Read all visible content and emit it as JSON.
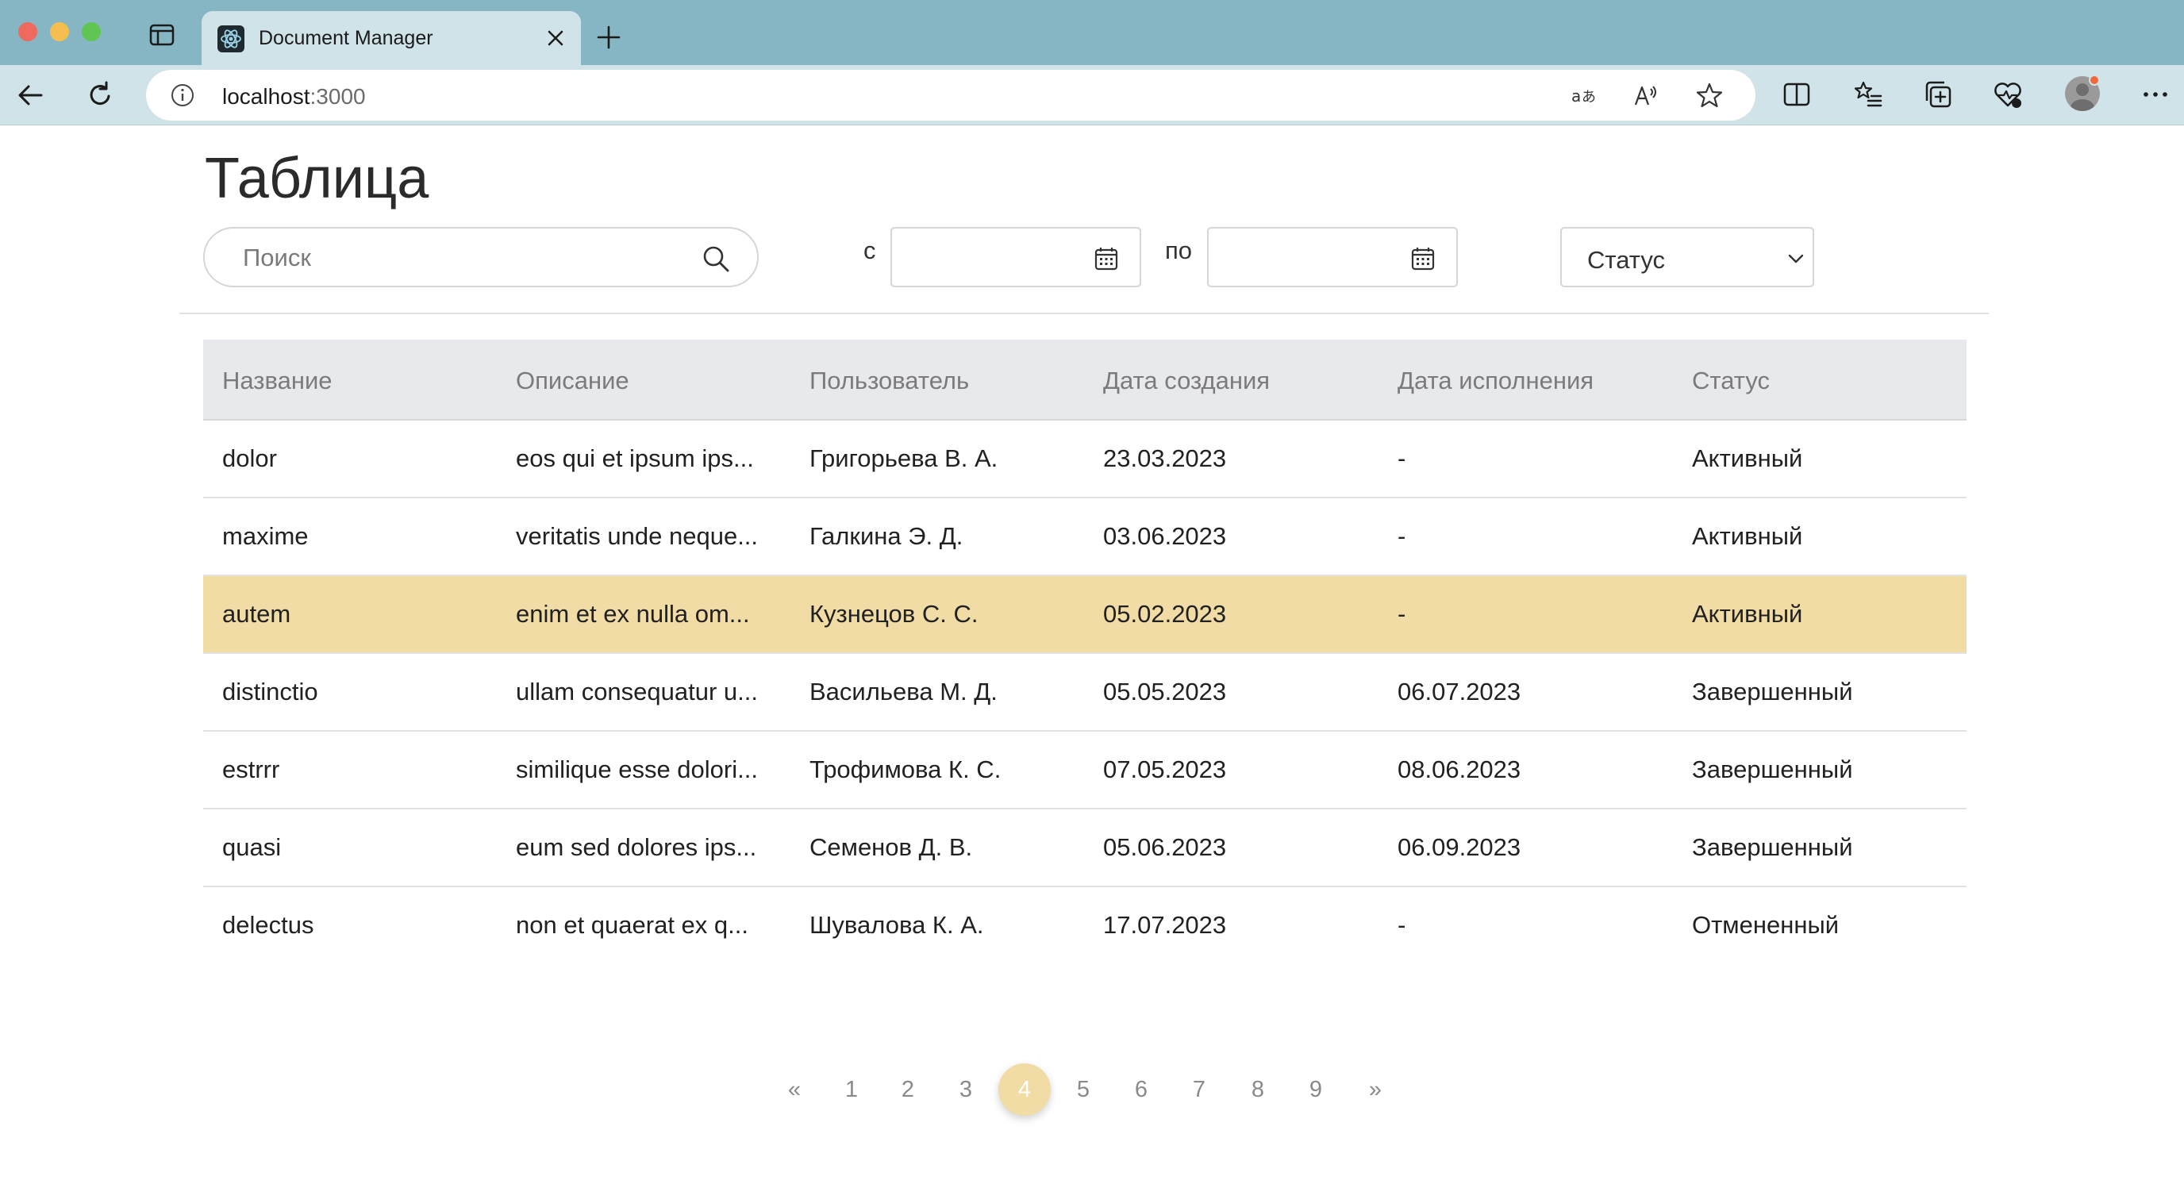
{
  "browser": {
    "tab_title": "Document Manager",
    "url_host": "localhost",
    "url_port": ":3000",
    "icons": [
      "sidebar-toggle-icon",
      "react-favicon-icon",
      "close-icon",
      "plus-icon",
      "back-arrow-icon",
      "reload-icon",
      "info-icon",
      "translate-icon",
      "read-aloud-icon",
      "favorite-star-icon",
      "split-screen-icon",
      "favorites-list-icon",
      "collections-icon",
      "health-heart-icon",
      "profile-avatar-icon",
      "more-menu-icon"
    ]
  },
  "page": {
    "title": "Таблица"
  },
  "filters": {
    "search_placeholder": "Поиск",
    "date_from_label": "с",
    "date_to_label": "по",
    "status_label": "Статус"
  },
  "table": {
    "headers": [
      "Название",
      "Описание",
      "Пользователь",
      "Дата создания",
      "Дата исполнения",
      "Статус"
    ],
    "rows": [
      [
        "dolor",
        "eos qui et ipsum ips...",
        "Григорьева В. А.",
        "23.03.2023",
        "-",
        "Активный"
      ],
      [
        "maxime",
        "veritatis unde neque...",
        "Галкина Э. Д.",
        "03.06.2023",
        "-",
        "Активный"
      ],
      [
        "autem",
        "enim et ex nulla om...",
        "Кузнецов С. С.",
        "05.02.2023",
        "-",
        "Активный"
      ],
      [
        "distinctio",
        "ullam consequatur u...",
        "Васильева М. Д.",
        "05.05.2023",
        "06.07.2023",
        "Завершенный"
      ],
      [
        "estrrr",
        "similique esse dolori...",
        "Трофимова К. С.",
        "07.05.2023",
        "08.06.2023",
        "Завершенный"
      ],
      [
        "quasi",
        "eum sed dolores ips...",
        "Семенов Д. В.",
        "05.06.2023",
        "06.09.2023",
        "Завершенный"
      ],
      [
        "delectus",
        "non et quaerat ex q...",
        "Шувалова К. А.",
        "17.07.2023",
        "-",
        "Отмененный"
      ]
    ],
    "selected_row": 2,
    "selected_color": "#f1dca6"
  },
  "pagination": {
    "prev": "«",
    "pages": [
      "1",
      "2",
      "3",
      "4",
      "5",
      "6",
      "7",
      "8",
      "9"
    ],
    "next": "»",
    "current": "4"
  },
  "colors": {
    "tabbar": "#86b6c3",
    "toolbar": "#cfe3e9",
    "header_row": "#e8e9ec",
    "accent": "#f1dca6"
  }
}
